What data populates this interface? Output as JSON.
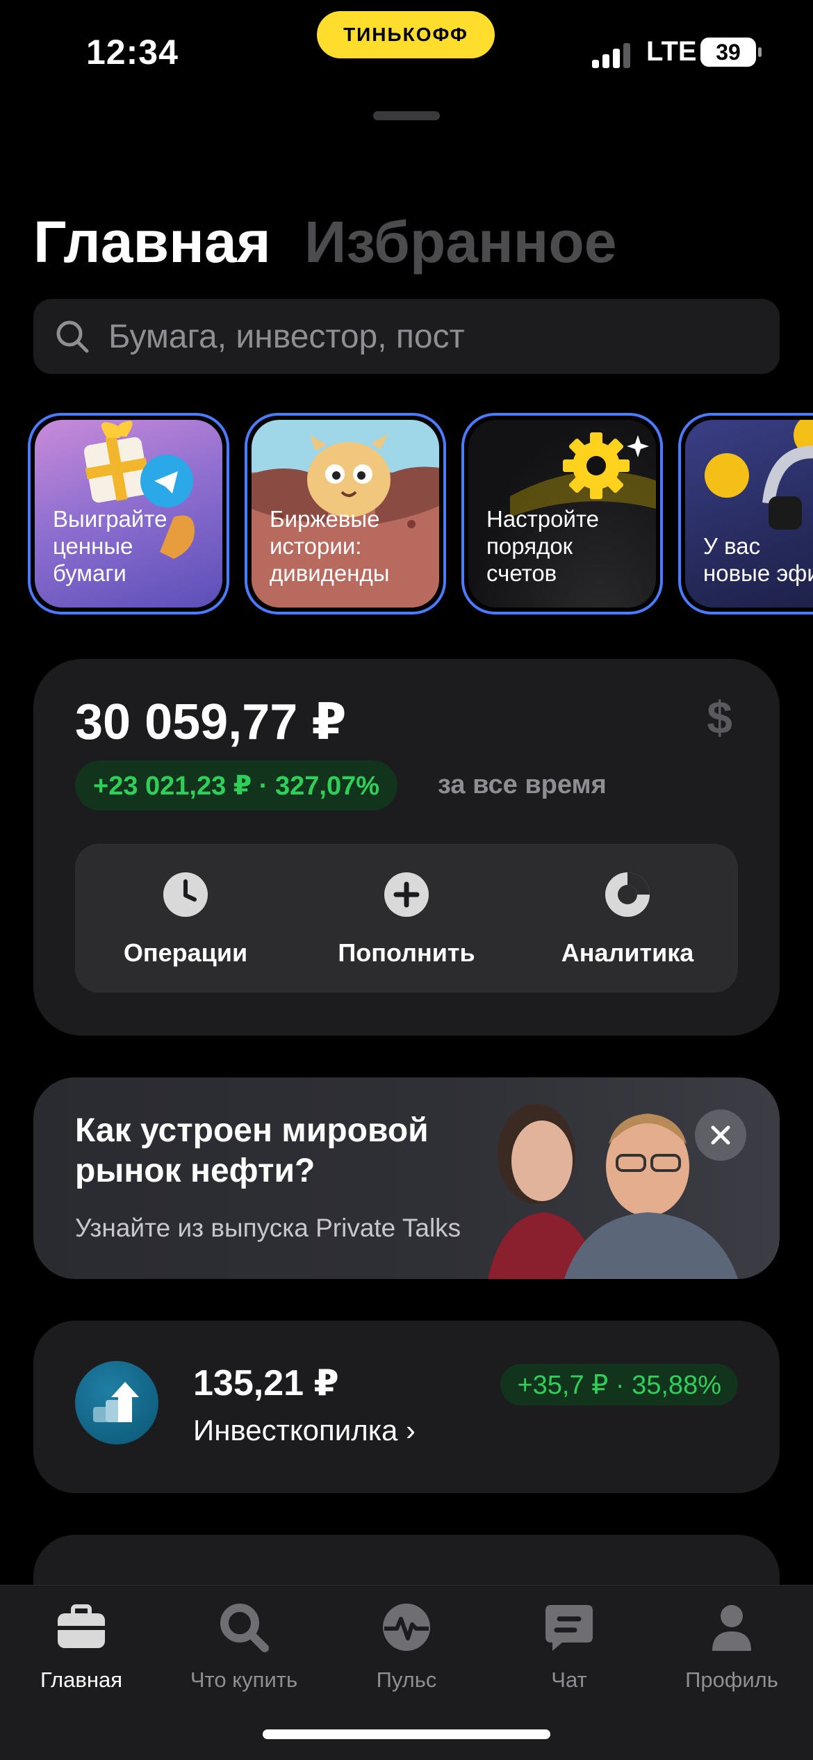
{
  "status_bar": {
    "time": "12:34",
    "brand": "ТИНЬКОФФ",
    "network": "LTE",
    "battery": "39"
  },
  "header": {
    "tabs": [
      {
        "label": "Главная",
        "active": true
      },
      {
        "label": "Избранное",
        "active": false
      }
    ]
  },
  "search": {
    "placeholder": "Бумага, инвестор, пост"
  },
  "stories": [
    {
      "text": "Выиграйте\nценные\nбумаги",
      "theme": "purple-gift"
    },
    {
      "text": "Биржевые\nистории:\nдивиденды",
      "theme": "red-hamster"
    },
    {
      "text": "Настройте\nпорядок\nсчетов",
      "theme": "dark-gear"
    },
    {
      "text": "У вас\nновые эфи",
      "theme": "blue-coins"
    }
  ],
  "portfolio": {
    "amount": "30 059,77 ₽",
    "currency_symbol": "$",
    "gain": "+23 021,23 ₽ · 327,07%",
    "period": "за все время",
    "actions": [
      {
        "label": "Операции",
        "icon": "clock-icon"
      },
      {
        "label": "Пополнить",
        "icon": "plus-icon"
      },
      {
        "label": "Аналитика",
        "icon": "pie-icon"
      }
    ]
  },
  "promo": {
    "title": "Как устроен мировой рынок нефти?",
    "subtitle": "Узнайте из выпуска Private Talks"
  },
  "piggy": {
    "amount": "135,21 ₽",
    "label": "Инвесткопилка ›",
    "gain": "+35,7 ₽ · 35,88%"
  },
  "tabbar": {
    "items": [
      {
        "label": "Главная",
        "icon": "briefcase-icon",
        "active": true
      },
      {
        "label": "Что купить",
        "icon": "search-icon",
        "active": false
      },
      {
        "label": "Пульс",
        "icon": "pulse-icon",
        "active": false
      },
      {
        "label": "Чат",
        "icon": "chat-icon",
        "active": false
      },
      {
        "label": "Профиль",
        "icon": "profile-icon",
        "active": false
      }
    ]
  },
  "colors": {
    "brand_yellow": "#ffdd2d",
    "gain_green": "#2fd05a",
    "story_border": "#4b7bff"
  }
}
